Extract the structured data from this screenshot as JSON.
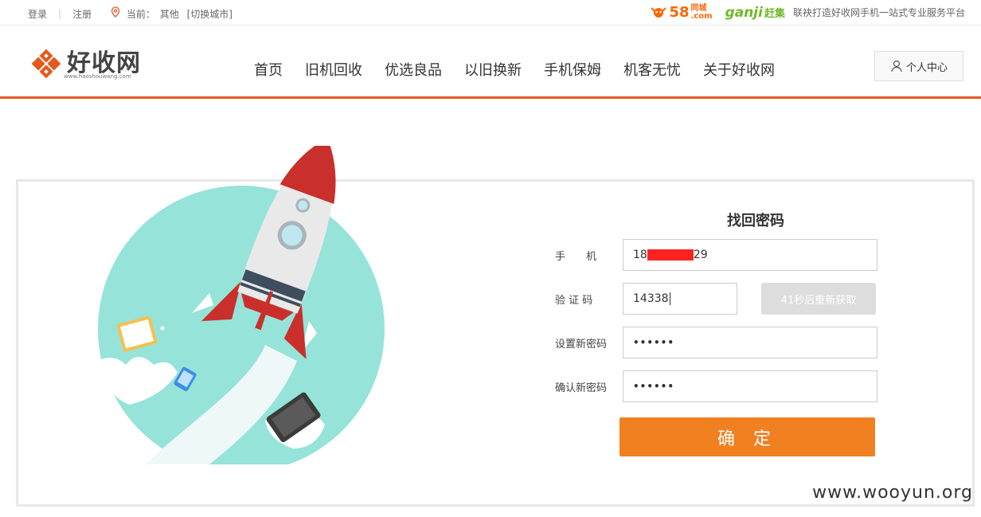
{
  "topbar": {
    "login": "登录",
    "register": "注册",
    "location_label": "当前：",
    "location_city": "其他",
    "switch_city": "[切换城市]",
    "partner_58": "58",
    "partner_58_cn": "同城",
    "partner_58_com": ".com",
    "partner_ganji": "ganji",
    "partner_ganji_cn": "赶集",
    "slogan": "联袂打造好收网手机一站式专业服务平台"
  },
  "header": {
    "logo_text": "好收网",
    "logo_url": "www.haoshouwang.com",
    "nav": [
      "首页",
      "旧机回收",
      "优选良品",
      "以旧换新",
      "手机保姆",
      "机客无忧",
      "关于好收网"
    ],
    "user_center": "个人中心"
  },
  "form": {
    "title": "找回密码",
    "phone_label": "手　　机",
    "phone_prefix": "18",
    "phone_suffix": "29",
    "code_label": "验 证 码",
    "code_value": "14338",
    "resend_label": "41秒后重新获取",
    "new_pw_label": "设置新密码",
    "new_pw_value": "••••••",
    "confirm_pw_label": "确认新密码",
    "confirm_pw_value": "••••••",
    "submit_label": "确 定"
  },
  "watermark": "www.wooyun.org",
  "colors": {
    "accent": "#e45a1e",
    "submit": "#f18021",
    "resend_disabled": "#dddddd",
    "illustration_circle": "#96e3d9",
    "rocket_red": "#c9302c"
  }
}
